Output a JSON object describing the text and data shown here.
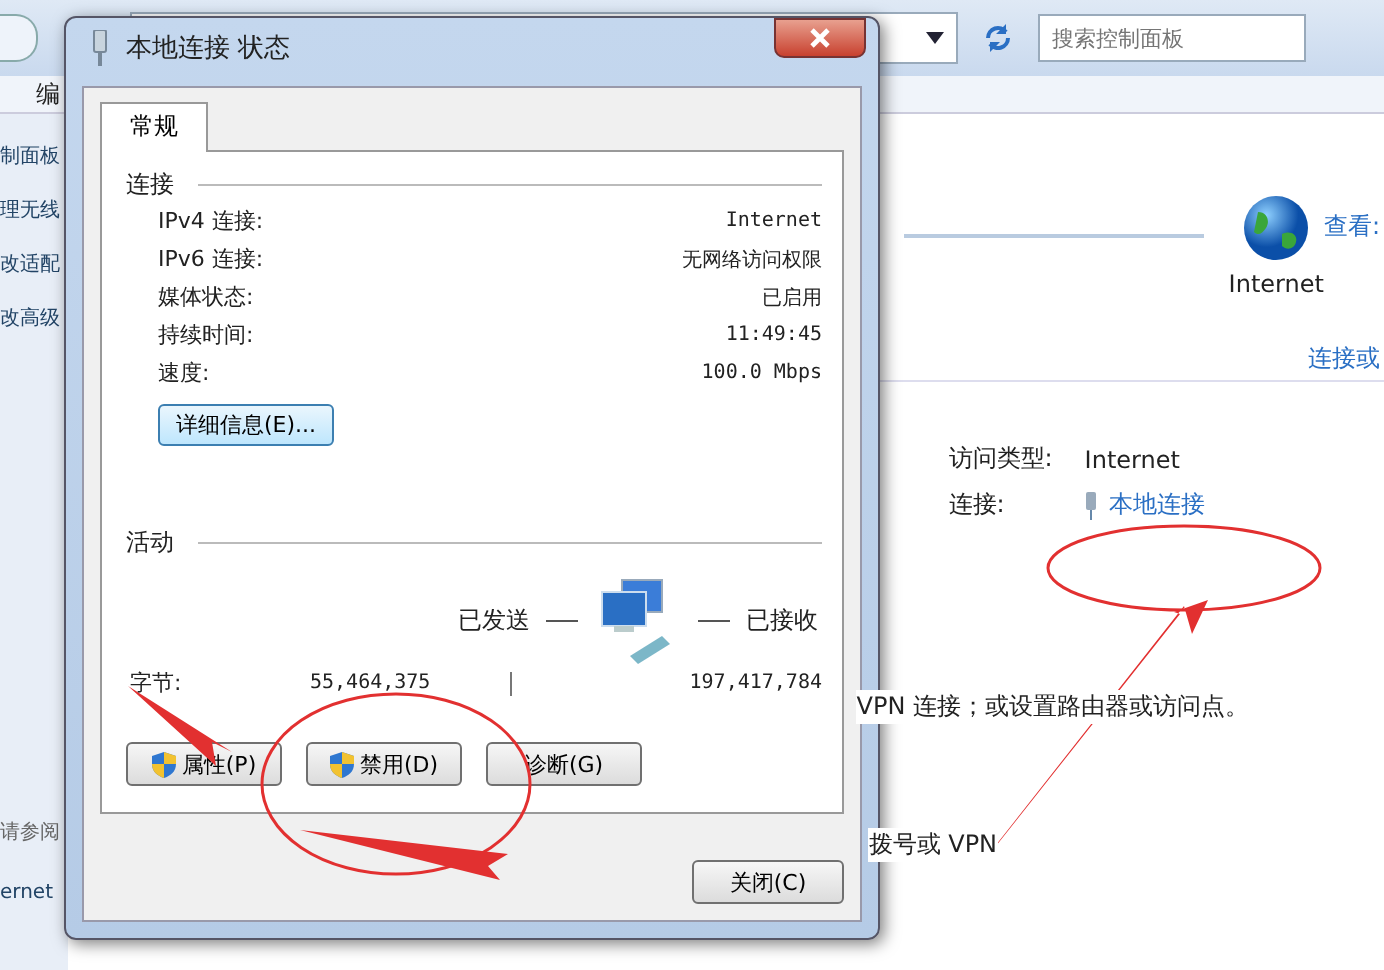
{
  "background_window": {
    "search": {
      "placeholder": "搜索控制面板"
    },
    "menu": [
      "编"
    ],
    "sidebar": {
      "items": [
        "制面板",
        "理无线",
        "改适配",
        "改高级"
      ],
      "see_also": "请参阅",
      "bottom_item": "ernet"
    },
    "network_map": {
      "view_link": "查看:",
      "node_label": "Internet",
      "connect_link": "连接或"
    },
    "active_network": {
      "rows": [
        {
          "label": "访问类型:",
          "value": "Internet",
          "kind": "text"
        },
        {
          "label": "连接:",
          "value": "本地连接",
          "kind": "link"
        }
      ]
    },
    "tasks": [
      "VPN 连接；或设置路由器或访问点。",
      "拨号或 VPN"
    ]
  },
  "dialog": {
    "title": "本地连接 状态",
    "tabs": [
      {
        "label": "常规",
        "selected": true
      }
    ],
    "connection": {
      "heading": "连接",
      "rows": [
        {
          "label": "IPv4 连接:",
          "value": "Internet"
        },
        {
          "label": "IPv6 连接:",
          "value": "无网络访问权限"
        },
        {
          "label": "媒体状态:",
          "value": "已启用"
        },
        {
          "label": "持续时间:",
          "value": "11:49:45"
        },
        {
          "label": "速度:",
          "value": "100.0 Mbps"
        }
      ],
      "details_button": "详细信息(E)..."
    },
    "activity": {
      "heading": "活动",
      "sent_label": "已发送",
      "received_label": "已接收",
      "bytes_label": "字节:",
      "sent": "55,464,375",
      "received": "197,417,784"
    },
    "buttons": [
      {
        "label": "属性(P)",
        "shield": true
      },
      {
        "label": "禁用(D)",
        "shield": true
      },
      {
        "label": "诊断(G)",
        "shield": false
      }
    ],
    "close_button": "关闭(C)"
  }
}
